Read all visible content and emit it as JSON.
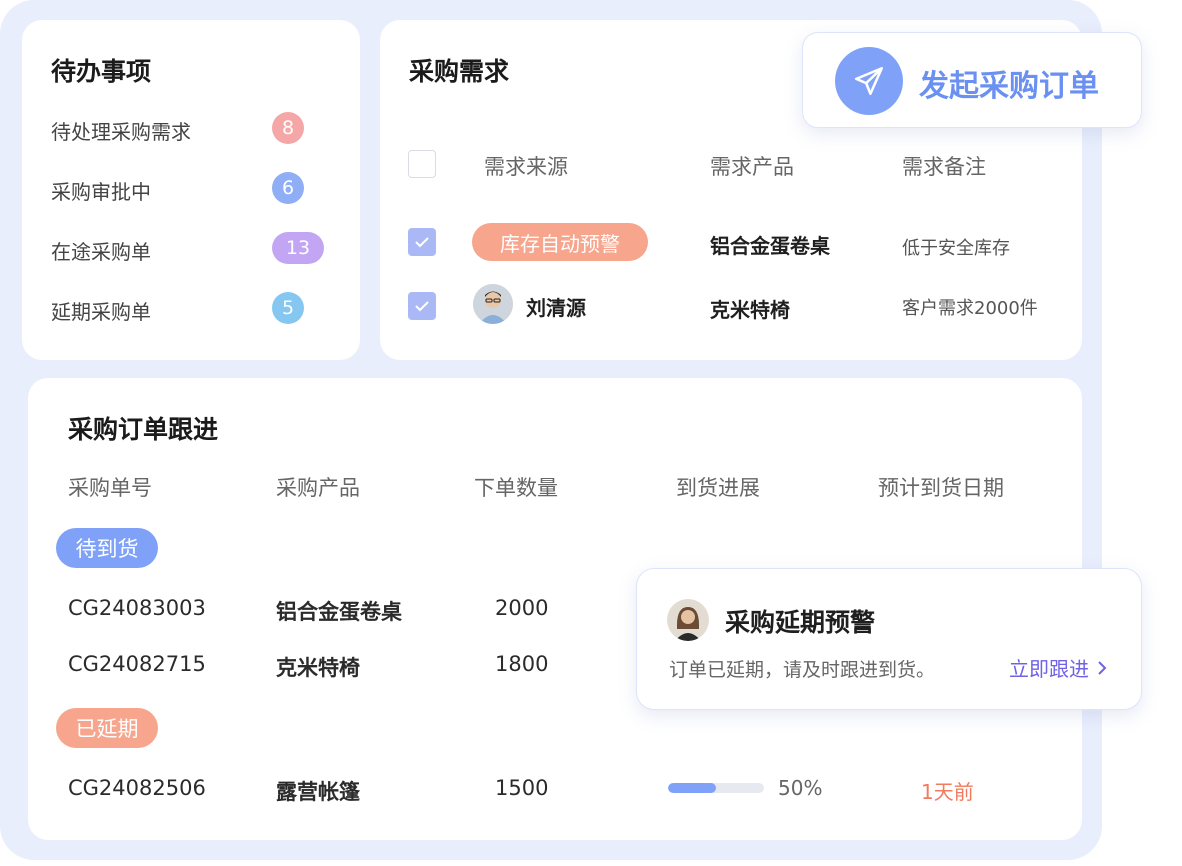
{
  "todo": {
    "title": "待办事项",
    "items": [
      {
        "label": "待处理采购需求",
        "count": "8",
        "color": "#f5a7a7"
      },
      {
        "label": "采购审批中",
        "count": "6",
        "color": "#90aef5"
      },
      {
        "label": "在途采购单",
        "count": "13",
        "color": "#c2a6f3"
      },
      {
        "label": "延期采购单",
        "count": "5",
        "color": "#86c7f2"
      }
    ]
  },
  "demand": {
    "title": "采购需求",
    "columns": [
      "需求来源",
      "需求产品",
      "需求备注"
    ],
    "rows": [
      {
        "source": "库存自动预警",
        "source_type": "tag",
        "product": "铝合金蛋卷桌",
        "note": "低于安全库存",
        "checked": true
      },
      {
        "source": "刘清源",
        "source_type": "person",
        "product": "克米特椅",
        "note": "客户需求2000件",
        "checked": true
      }
    ]
  },
  "launch": {
    "label": "发起采购订单",
    "icon": "paper-plane-icon"
  },
  "orders": {
    "title": "采购订单跟进",
    "columns": [
      "采购单号",
      "采购产品",
      "下单数量",
      "到货进展",
      "预计到货日期"
    ],
    "groups": [
      {
        "status": "待到货",
        "color": "#7fa2f8",
        "rows": [
          {
            "no": "CG24083003",
            "product": "铝合金蛋卷桌",
            "qty": "2000"
          },
          {
            "no": "CG24082715",
            "product": "克米特椅",
            "qty": "1800"
          }
        ]
      },
      {
        "status": "已延期",
        "color": "#f7a58d",
        "rows": [
          {
            "no": "CG24082506",
            "product": "露营帐篷",
            "qty": "1500",
            "progress": 0.5,
            "progress_label": "50%",
            "eta": "1天前"
          }
        ]
      }
    ]
  },
  "alert": {
    "title": "采购延期预警",
    "message": "订单已延期，请及时跟进到货。",
    "action": "立即跟进"
  }
}
